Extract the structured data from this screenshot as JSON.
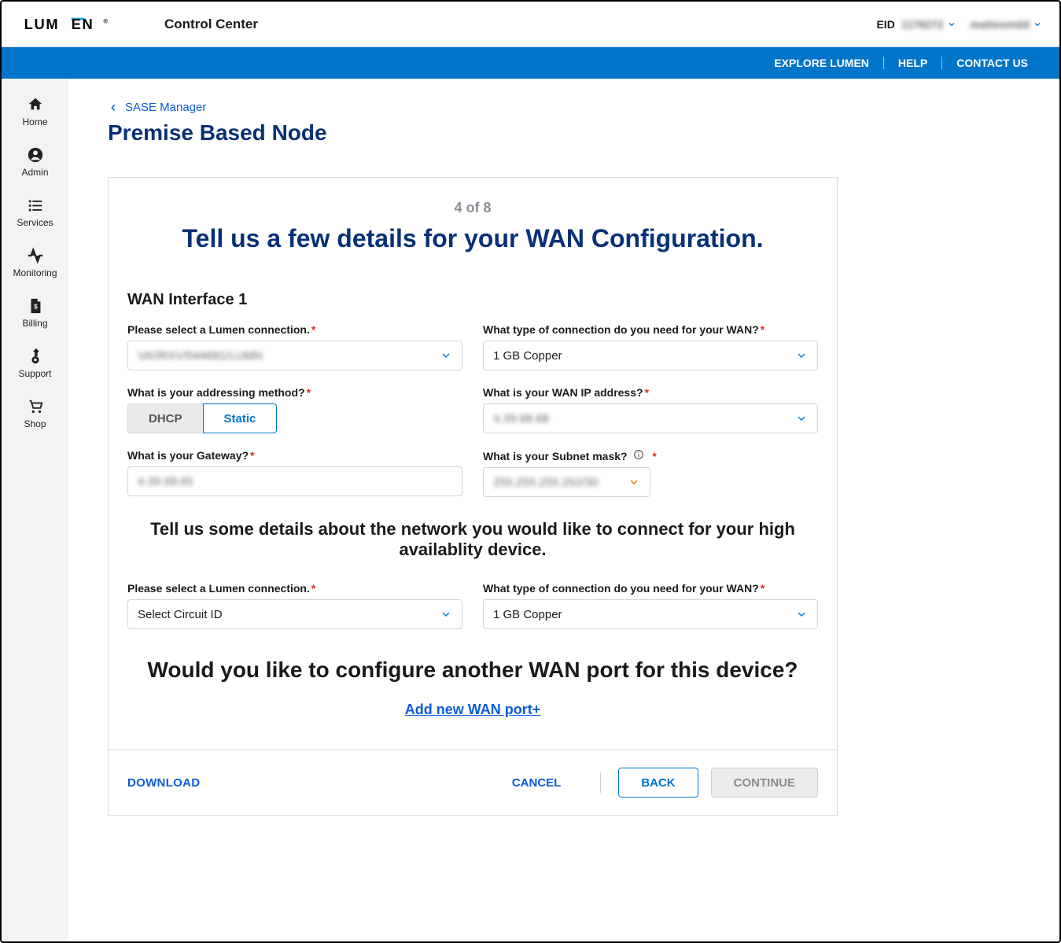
{
  "header": {
    "logo_text": "LUMEN",
    "app_title": "Control Center",
    "eid_label": "EID",
    "eid_value": "1178272",
    "user_name": "matteomdd"
  },
  "bluebar": {
    "explore": "EXPLORE LUMEN",
    "help": "HELP",
    "contact": "CONTACT US"
  },
  "sidenav": [
    {
      "key": "home",
      "label": "Home"
    },
    {
      "key": "admin",
      "label": "Admin"
    },
    {
      "key": "services",
      "label": "Services"
    },
    {
      "key": "monitoring",
      "label": "Monitoring"
    },
    {
      "key": "billing",
      "label": "Billing"
    },
    {
      "key": "support",
      "label": "Support"
    },
    {
      "key": "shop",
      "label": "Shop"
    }
  ],
  "breadcrumb": {
    "back_label": "SASE Manager"
  },
  "page_title": "Premise Based Node",
  "step": "4 of 8",
  "hero": "Tell us a few details for your WAN Configuration.",
  "wan1": {
    "section_title": "WAN Interface 1",
    "connection": {
      "label": "Please select a Lumen connection.",
      "value": "VA/IRXV/044681/LUMN"
    },
    "conn_type": {
      "label": "What type of connection do you need for your WAN?",
      "value": "1 GB Copper"
    },
    "addressing": {
      "label": "What is your addressing method?",
      "options": {
        "dhcp": "DHCP",
        "static": "Static"
      },
      "selected": "static"
    },
    "wan_ip": {
      "label": "What is your WAN IP address?",
      "value": "4.39.98.68"
    },
    "gateway": {
      "label": "What is your Gateway?",
      "value": "4.39.98.65"
    },
    "subnet": {
      "label": "What is your Subnet mask?",
      "value": "255.255.255.252/30"
    }
  },
  "ha": {
    "section_msg": "Tell us some details about the network you would like to connect for your high availablity device.",
    "connection": {
      "label": "Please select a Lumen connection.",
      "value": "Select Circuit ID"
    },
    "conn_type": {
      "label": "What type of connection do you need for your WAN?",
      "value": "1 GB Copper"
    }
  },
  "add_port": {
    "question": "Would you like to configure another WAN port for this device?",
    "link": "Add new WAN port+"
  },
  "footer": {
    "download": "DOWNLOAD",
    "cancel": "CANCEL",
    "back": "BACK",
    "continue": "CONTINUE"
  }
}
